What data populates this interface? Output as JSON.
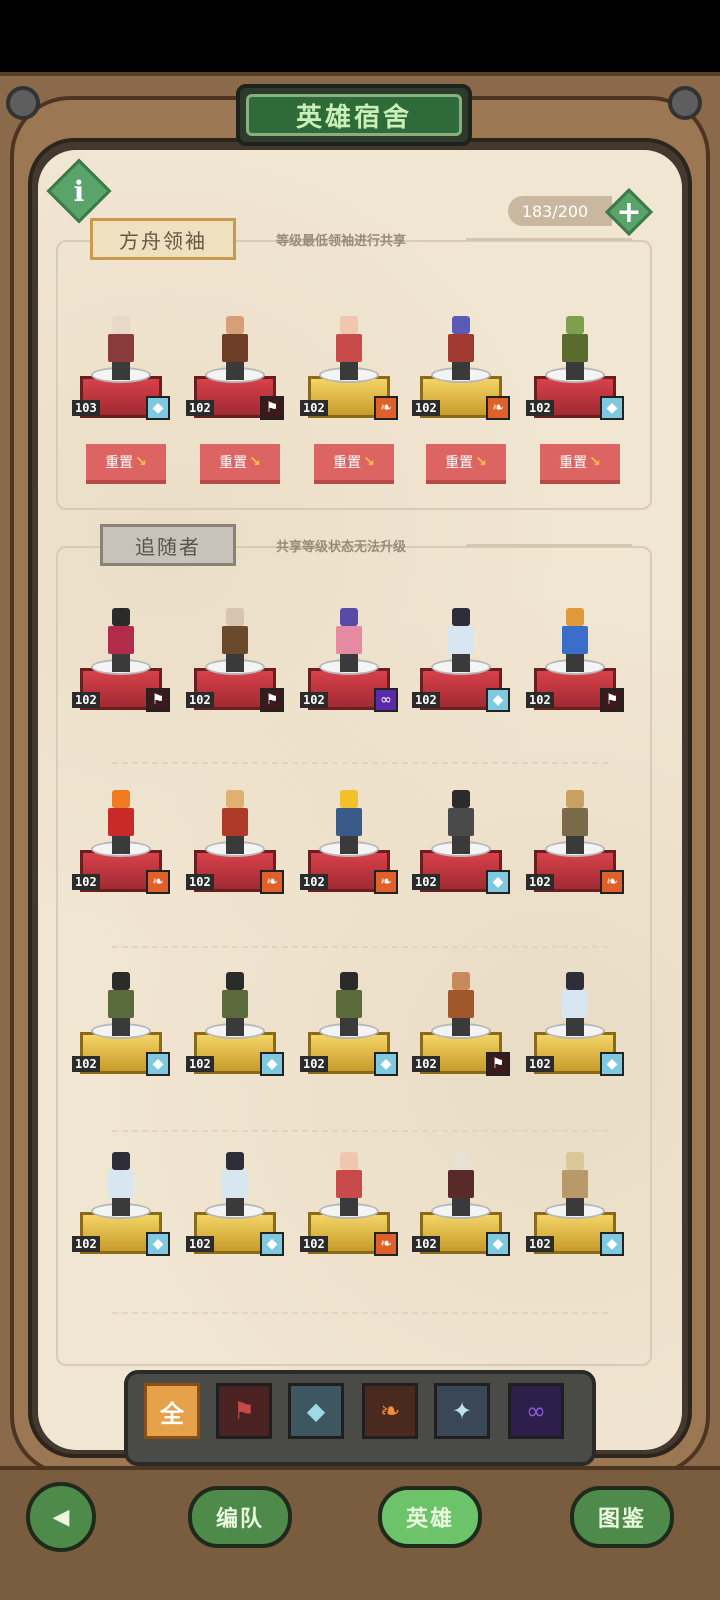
{
  "title": "英雄宿舍",
  "capacity": "183/200",
  "leader_section": {
    "tag": "方舟领袖",
    "note": "等级最低领袖进行共享",
    "reset_label": "重置",
    "heroes": [
      {
        "level": "103",
        "pedestal": "red",
        "faction": "wolf",
        "skin": "#e8d8c8",
        "outfit": "#8a3b3b"
      },
      {
        "level": "102",
        "pedestal": "red",
        "faction": "dark",
        "skin": "#d5a078",
        "outfit": "#6e3f26"
      },
      {
        "level": "102",
        "pedestal": "gold",
        "faction": "flame",
        "skin": "#f0c6b0",
        "outfit": "#c84a4a"
      },
      {
        "level": "102",
        "pedestal": "gold",
        "faction": "flame",
        "skin": "#5a5bb8",
        "outfit": "#a0392f"
      },
      {
        "level": "102",
        "pedestal": "red",
        "faction": "wolf",
        "skin": "#7ca04c",
        "outfit": "#5a6b2e"
      }
    ]
  },
  "follower_section": {
    "tag": "追随者",
    "note": "共享等级状态无法升级",
    "rows": [
      [
        {
          "level": "102",
          "pedestal": "red",
          "faction": "dark",
          "skin": "#2b2b2b",
          "outfit": "#b22b4a"
        },
        {
          "level": "102",
          "pedestal": "red",
          "faction": "dark",
          "skin": "#d8c4b0",
          "outfit": "#6b4a2c"
        },
        {
          "level": "102",
          "pedestal": "red",
          "faction": "void",
          "skin": "#5a4aa8",
          "outfit": "#e58aa0"
        },
        {
          "level": "102",
          "pedestal": "red",
          "faction": "wolf",
          "skin": "#2e2e3a",
          "outfit": "#d8e6f2"
        },
        {
          "level": "102",
          "pedestal": "red",
          "faction": "dark",
          "skin": "#e09a3a",
          "outfit": "#3a6ec8"
        }
      ],
      [
        {
          "level": "102",
          "pedestal": "red",
          "faction": "flame",
          "skin": "#f07a1e",
          "outfit": "#c82a2a"
        },
        {
          "level": "102",
          "pedestal": "red",
          "faction": "flame",
          "skin": "#e0b070",
          "outfit": "#b03a2a"
        },
        {
          "level": "102",
          "pedestal": "red",
          "faction": "flame",
          "skin": "#f2c02a",
          "outfit": "#3a5a8a"
        },
        {
          "level": "102",
          "pedestal": "red",
          "faction": "wolf",
          "skin": "#2b2b2b",
          "outfit": "#4a4a4a"
        },
        {
          "level": "102",
          "pedestal": "red",
          "faction": "flame",
          "skin": "#c8a060",
          "outfit": "#7a6a4a"
        }
      ],
      [
        {
          "level": "102",
          "pedestal": "gold",
          "faction": "wolf",
          "skin": "#2b2b2b",
          "outfit": "#5a6a3a"
        },
        {
          "level": "102",
          "pedestal": "gold",
          "faction": "wolf",
          "skin": "#2b2b2b",
          "outfit": "#5a6a3a"
        },
        {
          "level": "102",
          "pedestal": "gold",
          "faction": "wolf",
          "skin": "#2b2b2b",
          "outfit": "#5a6a3a"
        },
        {
          "level": "102",
          "pedestal": "gold",
          "faction": "dark",
          "skin": "#c88a5a",
          "outfit": "#a0582a"
        },
        {
          "level": "102",
          "pedestal": "gold",
          "faction": "wolf",
          "skin": "#2e2e3a",
          "outfit": "#d8e6f2"
        }
      ],
      [
        {
          "level": "102",
          "pedestal": "gold",
          "faction": "wolf",
          "skin": "#2e2e3a",
          "outfit": "#d8e6f2"
        },
        {
          "level": "102",
          "pedestal": "gold",
          "faction": "wolf",
          "skin": "#2e2e3a",
          "outfit": "#d8e6f2"
        },
        {
          "level": "102",
          "pedestal": "gold",
          "faction": "flame",
          "skin": "#f0c6b0",
          "outfit": "#c84a4a"
        },
        {
          "level": "102",
          "pedestal": "gold",
          "faction": "wolf",
          "skin": "#e8e0d0",
          "outfit": "#5a2a2a"
        },
        {
          "level": "102",
          "pedestal": "gold",
          "faction": "wolf",
          "skin": "#d8c89a",
          "outfit": "#b89a6a"
        }
      ]
    ]
  },
  "filters": [
    {
      "label": "全",
      "icon": "all-icon",
      "class": "f-all"
    },
    {
      "label": "⚑",
      "icon": "dark-faction-icon",
      "class": "f-dark"
    },
    {
      "label": "◆",
      "icon": "wolf-faction-icon",
      "class": "f-wolf"
    },
    {
      "label": "❧",
      "icon": "flame-faction-icon",
      "class": "f-flame"
    },
    {
      "label": "✦",
      "icon": "blue-faction-icon",
      "class": "f-blue"
    },
    {
      "label": "∞",
      "icon": "void-faction-icon",
      "class": "f-void"
    }
  ],
  "nav": {
    "team": "编队",
    "heroes": "英雄",
    "codex": "图鉴"
  },
  "faction_glyphs": {
    "wolf": "◆",
    "dark": "⚑",
    "flame": "❧",
    "void": "∞"
  },
  "faction_colors": {
    "wolf": "#7ec8e0",
    "dark": "#3a1a1a",
    "flame": "#e0602a",
    "void": "#5a2aa8"
  }
}
